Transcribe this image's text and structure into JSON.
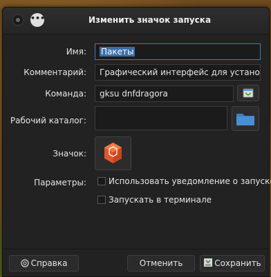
{
  "window": {
    "title": "Изменить значок запуска",
    "menu_glyph": "•••"
  },
  "form": {
    "name_label": "Имя:",
    "name_value": "Пакеты",
    "comment_label": "Комментарий:",
    "comment_value": "Графический интерфейс для установк",
    "command_label": "Команда:",
    "command_value": "gksu dnfdragora",
    "workdir_label": "Рабочий каталог:",
    "workdir_value": "",
    "icon_label": "Значок:",
    "params_label": "Параметры:",
    "options": [
      {
        "label": "Использовать уведомление о запуске",
        "checked": false
      },
      {
        "label": "Запускать в терминале",
        "checked": false
      }
    ]
  },
  "footer": {
    "help_label": "Справка",
    "cancel_label": "Отменить",
    "save_label": "Сохранить"
  },
  "icons": {
    "close": "close-icon",
    "menu": "menu-icon",
    "command_browse": "browse-application-icon",
    "folder": "folder-icon",
    "launcher": "package-cube-icon",
    "help": "help-icon",
    "save": "save-icon"
  },
  "colors": {
    "selection": "#3b6ea8",
    "folder": "#4a8fd6",
    "launcher_icon": "#e0582a"
  }
}
